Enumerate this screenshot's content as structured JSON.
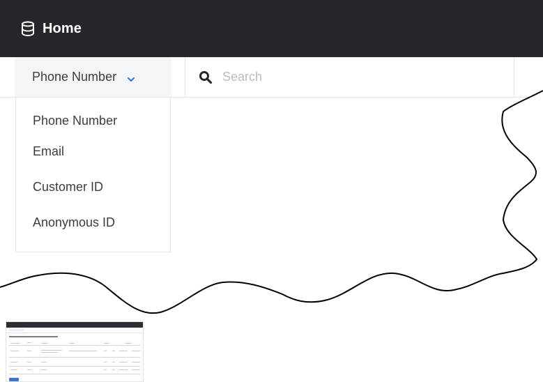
{
  "header": {
    "title": "Home",
    "icon": "database-icon",
    "background": "#24272c"
  },
  "search": {
    "type_selected": "Phone Number",
    "placeholder": "Search",
    "value": ""
  },
  "dropdown": {
    "items": [
      {
        "label": "Phone Number"
      },
      {
        "label": "Email"
      },
      {
        "label": "Customer ID"
      },
      {
        "label": "Anonymous ID"
      }
    ]
  },
  "colors": {
    "accent": "#2f6fdb",
    "text": "#3a3d42",
    "placeholder": "#b7bcc3",
    "select_bg": "#f4f5f7"
  }
}
